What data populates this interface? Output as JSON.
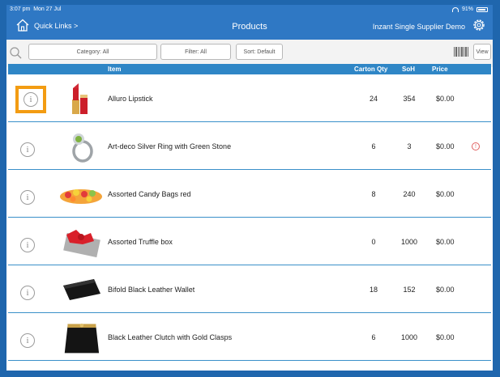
{
  "status": {
    "time": "3:07 pm",
    "date": "Mon 27 Jul",
    "battery": "91%"
  },
  "nav": {
    "quick_links": "Quick Links >",
    "title": "Products",
    "supplier": "Inzant Single Supplier Demo"
  },
  "filters": {
    "category": "Category: All",
    "filter": "Filter: All",
    "sort": "Sort: Default",
    "view": "View"
  },
  "table": {
    "headers": {
      "item": "Item",
      "carton_qty": "Carton Qty",
      "soh": "SoH",
      "price": "Price"
    },
    "rows": [
      {
        "name": "Alluro Lipstick",
        "carton_qty": "24",
        "soh": "354",
        "price": "$0.00",
        "thumb": "lipstick"
      },
      {
        "name": "Art-deco Silver Ring with Green Stone",
        "carton_qty": "6",
        "soh": "3",
        "price": "$0.00",
        "thumb": "ring",
        "alert": "!"
      },
      {
        "name": "Assorted Candy Bags red",
        "carton_qty": "8",
        "soh": "240",
        "price": "$0.00",
        "thumb": "candy"
      },
      {
        "name": "Assorted Truffle box",
        "carton_qty": "0",
        "soh": "1000",
        "price": "$0.00",
        "thumb": "truffle-box"
      },
      {
        "name": "Bifold Black Leather Wallet",
        "carton_qty": "18",
        "soh": "152",
        "price": "$0.00",
        "thumb": "wallet"
      },
      {
        "name": "Black Leather Clutch with Gold Clasps",
        "carton_qty": "6",
        "soh": "1000",
        "price": "$0.00",
        "thumb": "clutch"
      }
    ]
  },
  "info_glyph": "i",
  "colors": {
    "frame": "#1f66ad",
    "topbar": "#2f78c4",
    "header": "#2f86c6",
    "selected": "#f39c12",
    "divider": "#3a90c9"
  }
}
